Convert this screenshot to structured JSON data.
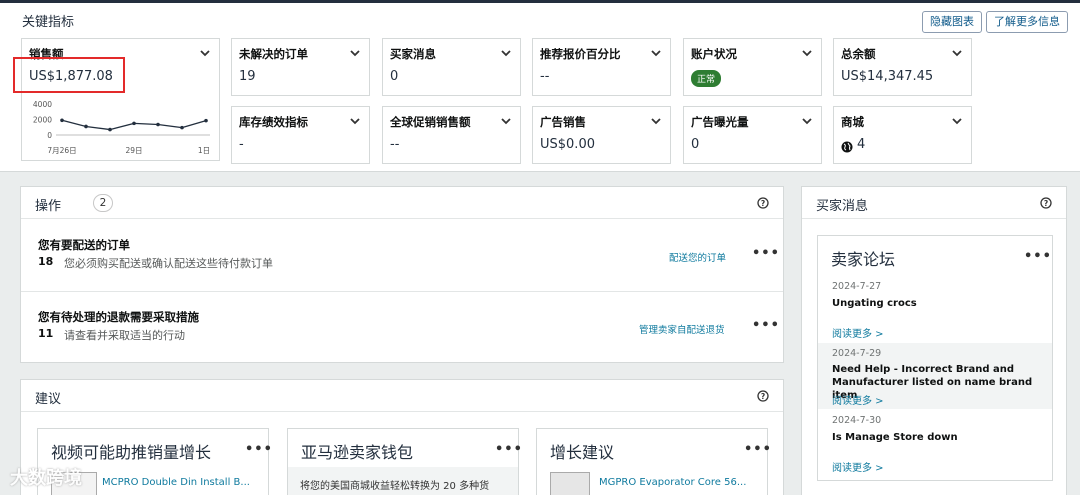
{
  "header": {
    "title": "关键指标",
    "hide_chart_label": "隐藏图表",
    "learn_more_label": "了解更多信息"
  },
  "kpis": {
    "sales": {
      "label": "销售额",
      "value": "US$1,877.08"
    },
    "unshipped_orders": {
      "label": "未解决的订单",
      "value": "19"
    },
    "buyer_messages": {
      "label": "买家消息",
      "value": "0"
    },
    "featured_offer": {
      "label": "推荐报价百分比",
      "value": "--"
    },
    "account_health": {
      "label": "账户状况",
      "value": "正常"
    },
    "total_balance": {
      "label": "总余额",
      "value": "US$14,347.45"
    },
    "inventory_perf": {
      "label": "库存绩效指标",
      "value": "-"
    },
    "global_promo": {
      "label": "全球促销销售额",
      "value": "--"
    },
    "ad_sales": {
      "label": "广告销售",
      "value": "US$0.00"
    },
    "ad_impressions": {
      "label": "广告曝光量",
      "value": "0"
    },
    "marketplace": {
      "label": "商城",
      "value": "4"
    }
  },
  "chart_data": {
    "type": "line",
    "x_ticks": [
      "7月26日",
      "29日",
      "1日"
    ],
    "y_ticks": [
      "4000",
      "2000",
      "0"
    ],
    "ylim": [
      0,
      4000
    ],
    "values": [
      1900,
      1100,
      700,
      1500,
      1350,
      950,
      1850
    ],
    "color": "#232f3e"
  },
  "actions": {
    "title": "操作",
    "count": "2",
    "tasks": [
      {
        "title": "您有要配送的订单",
        "count": "18",
        "desc": "您必须购买配送或确认配送这些待付款订单",
        "link": "配送您的订单"
      },
      {
        "title": "您有待处理的退款需要采取措施",
        "count": "11",
        "desc": "请查看并采取适当的行动",
        "link": "管理卖家自配送退货"
      }
    ]
  },
  "recommendations": {
    "title": "建议",
    "cards": [
      {
        "title": "视频可能助推销量增长",
        "text": "MCPRO Double Din Install B..."
      },
      {
        "title": "亚马逊卖家钱包",
        "text": "将您的美国商城收益轻松转换为 20 多种货"
      },
      {
        "title": "增长建议",
        "text": "MGPRO Evaporator Core 56..."
      }
    ]
  },
  "buyer_messages_panel": {
    "title": "买家消息",
    "forum": {
      "title": "卖家论坛",
      "items": [
        {
          "date": "2024-7-27",
          "title": "Ungating crocs",
          "more": "阅读更多 >"
        },
        {
          "date": "2024-7-29",
          "title": "Need Help - Incorrect Brand and Manufacturer listed on name brand item",
          "more": "阅读更多 >"
        },
        {
          "date": "2024-7-30",
          "title": "Is Manage Store down",
          "more": "阅读更多 >"
        }
      ]
    }
  },
  "watermark": "大数跨境"
}
